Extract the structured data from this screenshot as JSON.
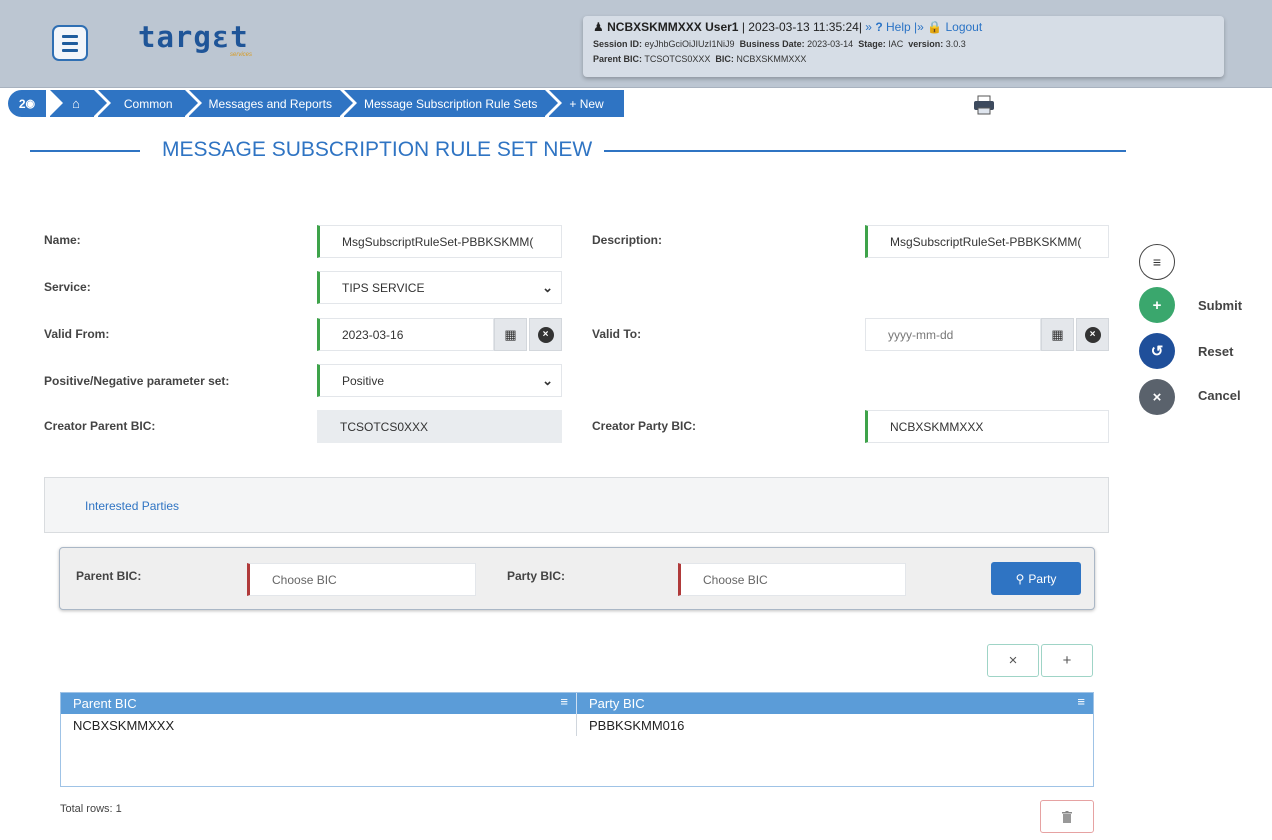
{
  "header": {
    "logo_text": "targɛt",
    "logo_sub": "services",
    "user_name": "NCBXSKMMXXX User1",
    "datetime": "| 2023-03-13 11:35:24|",
    "help_sep": "»",
    "help_label": "Help",
    "logout_sep": "|»",
    "logout_label": "Logout",
    "session_label": "Session ID:",
    "session_value": "eyJhbGciOiJIUzI1NiJ9",
    "business_date_label": "Business Date:",
    "business_date_value": "2023-03-14",
    "stage_label": "Stage:",
    "stage_value": "IAC",
    "version_label": "version:",
    "version_value": "3.0.3",
    "parent_bic_label": "Parent BIC:",
    "parent_bic_value": "TCSOTCS0XXX",
    "bic_label": "BIC:",
    "bic_value": "NCBXSKMMXXX"
  },
  "breadcrumb": {
    "history_count": "2",
    "items": [
      "Common",
      "Messages and Reports",
      "Message Subscription Rule Sets",
      "+ New"
    ]
  },
  "page": {
    "title": "MESSAGE SUBSCRIPTION RULE SET NEW"
  },
  "form": {
    "name_label": "Name:",
    "name_value": "MsgSubscriptRuleSet-PBBKSKMM(",
    "description_label": "Description:",
    "description_value": "MsgSubscriptRuleSet-PBBKSKMM(",
    "service_label": "Service:",
    "service_value": "TIPS SERVICE",
    "valid_from_label": "Valid From:",
    "valid_from_value": "2023-03-16",
    "valid_to_label": "Valid To:",
    "valid_to_placeholder": "yyyy-mm-dd",
    "posneg_label": "Positive/Negative parameter set:",
    "posneg_value": "Positive",
    "creator_parent_label": "Creator Parent BIC:",
    "creator_parent_value": "TCSOTCS0XXX",
    "creator_party_label": "Creator Party BIC:",
    "creator_party_value": "NCBXSKMMXXX"
  },
  "actions": {
    "submit": "Submit",
    "reset": "Reset",
    "cancel": "Cancel"
  },
  "interested": {
    "tab_label": "Interested Parties",
    "parent_bic_label": "Parent BIC:",
    "parent_bic_placeholder": "Choose BIC",
    "party_bic_label": "Party BIC:",
    "party_bic_placeholder": "Choose BIC",
    "party_button": "Party"
  },
  "grid": {
    "columns": [
      "Parent BIC",
      "Party BIC"
    ],
    "rows": [
      [
        "NCBXSKMMXXX",
        "PBBKSKMM016"
      ]
    ],
    "total_rows": "Total rows: 1"
  },
  "colors": {
    "accent": "#2f74c3",
    "valid": "#3ea34a",
    "invalid": "#b03a3a",
    "submit": "#3aa76d",
    "reset": "#1f4f9a",
    "cancel": "#5a626c"
  }
}
